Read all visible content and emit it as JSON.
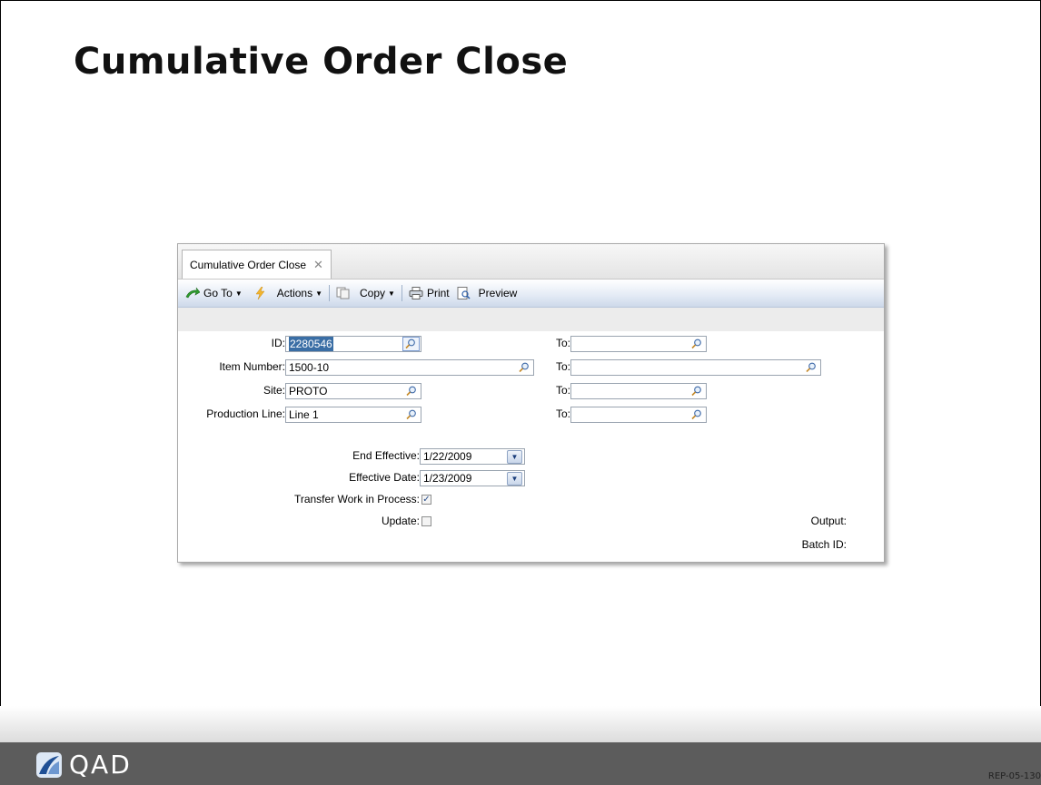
{
  "slide": {
    "title": "Cumulative Order Close",
    "footer_code": "REP-05-130",
    "logo_text": "QAD"
  },
  "window": {
    "tab_label": "Cumulative Order Close",
    "toolbar": {
      "goto_label": "Go To",
      "actions_label": "Actions",
      "copy_label": "Copy",
      "print_label": "Print",
      "preview_label": "Preview"
    }
  },
  "form": {
    "id_label": "ID:",
    "id_value": "2280546",
    "item_label": "Item Number:",
    "item_value": "1500-10",
    "site_label": "Site:",
    "site_value": "PROTO",
    "line_label": "Production Line:",
    "line_value": "Line 1",
    "to_label": "To:",
    "id_to": "",
    "item_to": "",
    "site_to": "",
    "line_to": "",
    "end_effective_label": "End Effective:",
    "end_effective_value": "1/22/2009",
    "effective_date_label": "Effective Date:",
    "effective_date_value": "1/23/2009",
    "transfer_wip_label": "Transfer Work in Process:",
    "transfer_wip_checked": true,
    "update_label": "Update:",
    "update_checked": false,
    "output_label": "Output:",
    "batch_id_label": "Batch ID:"
  },
  "colors": {
    "footer": "#5c5c5c",
    "selection": "#3a6ea5",
    "toolbar_blue": "#cdd9ea"
  }
}
